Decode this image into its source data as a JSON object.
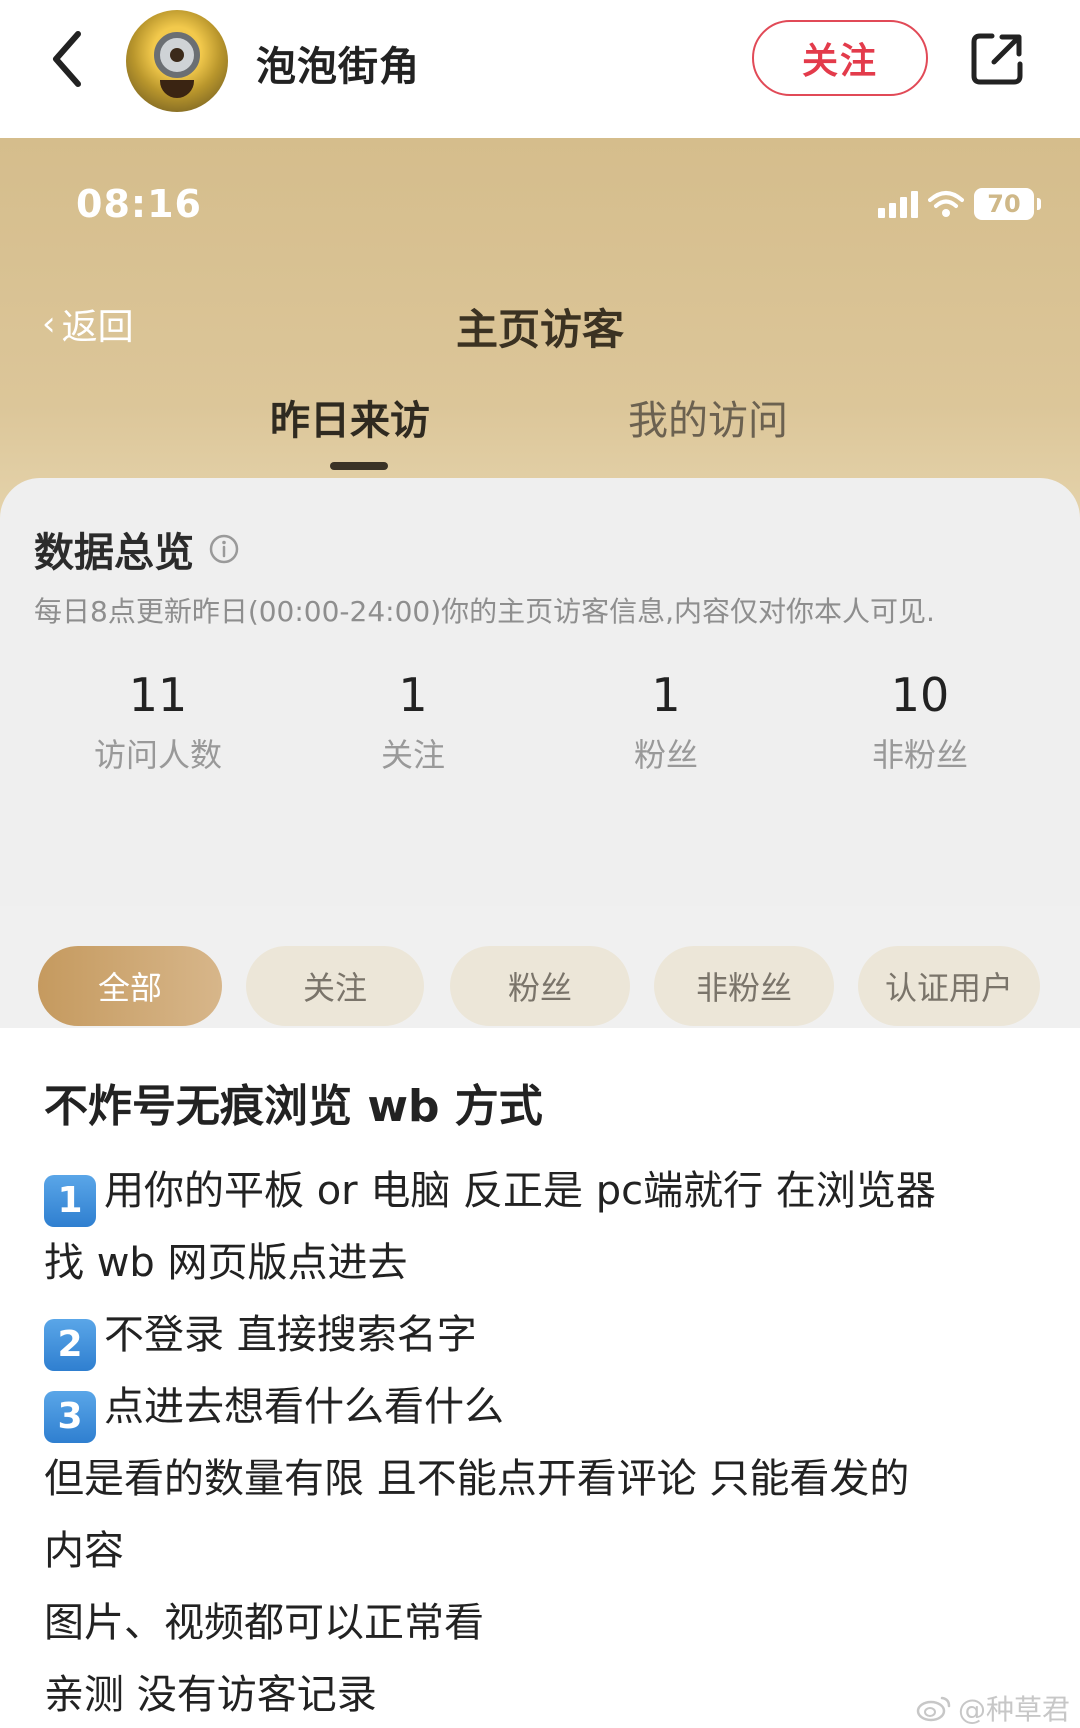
{
  "header": {
    "username": "泡泡街角",
    "follow_label": "关注"
  },
  "screenshot": {
    "status": {
      "time": "08:16",
      "battery": "70"
    },
    "nav": {
      "back_label": "返回",
      "title": "主页访客"
    },
    "tabs": [
      {
        "label": "昨日来访",
        "active": true
      },
      {
        "label": "我的访问",
        "active": false
      }
    ],
    "overview": {
      "title": "数据总览",
      "subtitle": "每日8点更新昨日(00:00-24:00)你的主页访客信息,内容仅对你本人可见.",
      "stats": [
        {
          "value": "11",
          "label": "访问人数"
        },
        {
          "value": "1",
          "label": "关注"
        },
        {
          "value": "1",
          "label": "粉丝"
        },
        {
          "value": "10",
          "label": "非粉丝"
        }
      ]
    },
    "filters": [
      {
        "label": "全部",
        "active": true
      },
      {
        "label": "关注",
        "active": false
      },
      {
        "label": "粉丝",
        "active": false
      },
      {
        "label": "非粉丝",
        "active": false
      },
      {
        "label": "认证用户",
        "active": false
      }
    ]
  },
  "post": {
    "title": "不炸号无痕浏览 wb 方式",
    "step1_num": "1",
    "step1_text": "用你的平板 or 电脑 反正是 pc端就行 在浏览器",
    "step1_cont": "找 wb 网页版点进去",
    "step2_num": "2",
    "step2_text": "不登录 直接搜索名字",
    "step3_num": "3",
    "step3_text": "点进去想看什么看什么",
    "line4": "但是看的数量有限 且不能点开看评论 只能看发的",
    "line4_cont": "内容",
    "line5": "图片、视频都可以正常看",
    "line6": "亲测 没有访客记录"
  },
  "watermark": "@种草君"
}
